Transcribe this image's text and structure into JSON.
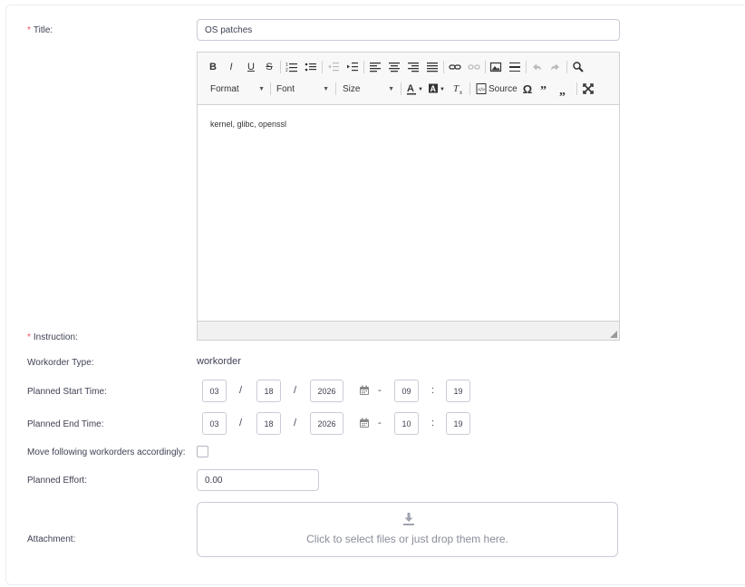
{
  "form": {
    "title_label": "Title:",
    "title_value": "OS patches",
    "instruction_label": "Instruction:",
    "required_mark": "*",
    "workorder_type_label": "Workorder Type:",
    "workorder_type_value": "workorder",
    "planned_start_label": "Planned Start Time:",
    "planned_end_label": "Planned End Time:",
    "move_following_label": "Move following workorders accordingly:",
    "move_following_checked": false,
    "planned_effort_label": "Planned Effort:",
    "planned_effort_value": "0.00",
    "attachment_label": "Attachment:",
    "dropzone_text": "Click to select files or just drop them here."
  },
  "editor": {
    "content": "kernel, glibc, openssl",
    "format_label": "Format",
    "font_label": "Font",
    "size_label": "Size",
    "source_label": "Source",
    "bold": "B",
    "italic": "I",
    "underline": "U",
    "strike": "S",
    "omega": "Ω"
  },
  "start_time": {
    "month": "03",
    "day": "18",
    "year": "2026",
    "hour": "09",
    "minute": "19"
  },
  "end_time": {
    "month": "03",
    "day": "18",
    "year": "2026",
    "hour": "10",
    "minute": "19"
  },
  "separators": {
    "date": "/",
    "range": "-",
    "time": ":"
  },
  "colors": {
    "required": "#f64e60",
    "border": "#c9ccd6",
    "text": "#3f4254"
  }
}
